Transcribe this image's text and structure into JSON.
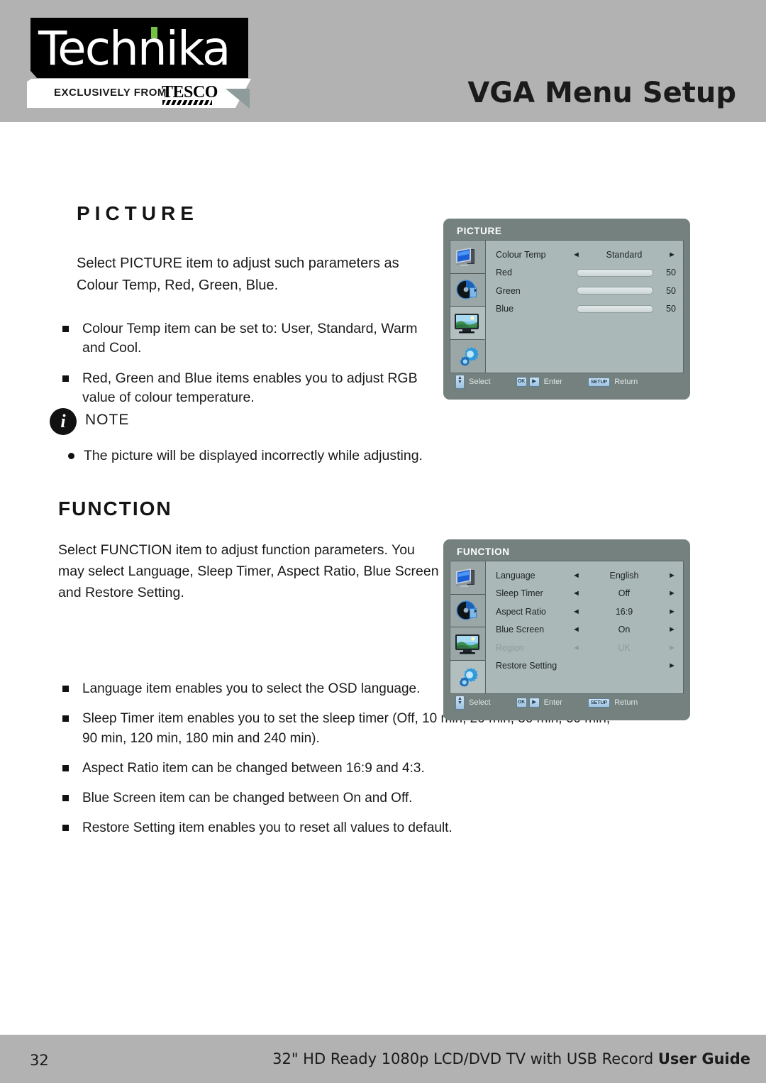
{
  "header": {
    "logo_word": "Technika",
    "logo_exclusively": "EXCLUSIVELY FROM",
    "logo_tesco": "TESCO",
    "title": "VGA Menu Setup"
  },
  "picture_section": {
    "heading": "PICTURE",
    "paragraph": "Select PICTURE item to adjust such parameters as Colour Temp, Red, Green, Blue.",
    "bullets": [
      "Colour Temp item can be set to: User, Standard, Warm and Cool.",
      "Red, Green and Blue items enables you to adjust RGB value of colour temperature."
    ],
    "note": {
      "label": "NOTE",
      "items": [
        "The picture will be displayed incorrectly while adjusting."
      ]
    }
  },
  "function_section": {
    "heading": "FUNCTION",
    "paragraph": "Select FUNCTION item to adjust function parameters. You may select Language, Sleep Timer, Aspect Ratio, Blue Screen and Restore Setting.",
    "bullets": [
      "Language item enables you to select the OSD language.",
      "Sleep Timer item enables you to set the sleep timer (Off, 10 min, 20 min, 30 min, 60 min, 90 min, 120 min, 180 min and 240 min).",
      "Aspect Ratio item can be changed between 16:9 and 4:3.",
      "Blue Screen item can be changed between On and  Off.",
      "Restore Setting item enables you to reset all values to  default."
    ]
  },
  "osd_picture": {
    "title": "PICTURE",
    "sidebar_icons": [
      "monitor-pc-icon",
      "disc-dvd-icon",
      "tv-picture-icon",
      "gears-settings-icon"
    ],
    "active_icon_index": 2,
    "rows": [
      {
        "label": "Colour Temp",
        "type": "option",
        "arrow_left": "◄",
        "value": "Standard",
        "arrow_right": "►"
      },
      {
        "label": "Red",
        "type": "slider",
        "value": "50",
        "percent": 50
      },
      {
        "label": "Green",
        "type": "slider",
        "value": "50",
        "percent": 50
      },
      {
        "label": "Blue",
        "type": "slider",
        "value": "50",
        "percent": 50
      }
    ],
    "footer": {
      "select_label": "Select",
      "enter_label": "Enter",
      "return_label": "Return",
      "ok_chip": "OK",
      "right_chip": "▶",
      "setup_chip": "SETUP"
    }
  },
  "osd_function": {
    "title": "FUNCTION",
    "sidebar_icons": [
      "monitor-pc-icon",
      "disc-dvd-icon",
      "tv-picture-icon",
      "gears-settings-icon"
    ],
    "active_icon_index": 3,
    "rows": [
      {
        "label": "Language",
        "arrow_left": "◄",
        "value": "English",
        "arrow_right": "►",
        "disabled": false
      },
      {
        "label": "Sleep Timer",
        "arrow_left": "◄",
        "value": "Off",
        "arrow_right": "►",
        "disabled": false
      },
      {
        "label": "Aspect Ratio",
        "arrow_left": "◄",
        "value": "16:9",
        "arrow_right": "►",
        "disabled": false
      },
      {
        "label": "Blue Screen",
        "arrow_left": "◄",
        "value": "On",
        "arrow_right": "►",
        "disabled": false
      },
      {
        "label": "Region",
        "arrow_left": "◄",
        "value": "UK",
        "arrow_right": "►",
        "disabled": true
      },
      {
        "label": "Restore Setting",
        "arrow_left": "",
        "value": "",
        "arrow_right": "►",
        "disabled": false
      }
    ],
    "footer": {
      "select_label": "Select",
      "enter_label": "Enter",
      "return_label": "Return",
      "ok_chip": "OK",
      "right_chip": "▶",
      "setup_chip": "SETUP"
    }
  },
  "footer": {
    "page_number": "32",
    "product_line": "32\" HD Ready 1080p LCD/DVD TV with USB Record ",
    "guide_label": "User Guide"
  },
  "colors": {
    "band_gray": "#b2b2b2",
    "osd_frame": "#74817f",
    "osd_panel": "#aab8b7",
    "osd_sidebar": "#9aa7a6",
    "logo_green": "#76c043",
    "chip_blue": "#9dc2e0"
  }
}
